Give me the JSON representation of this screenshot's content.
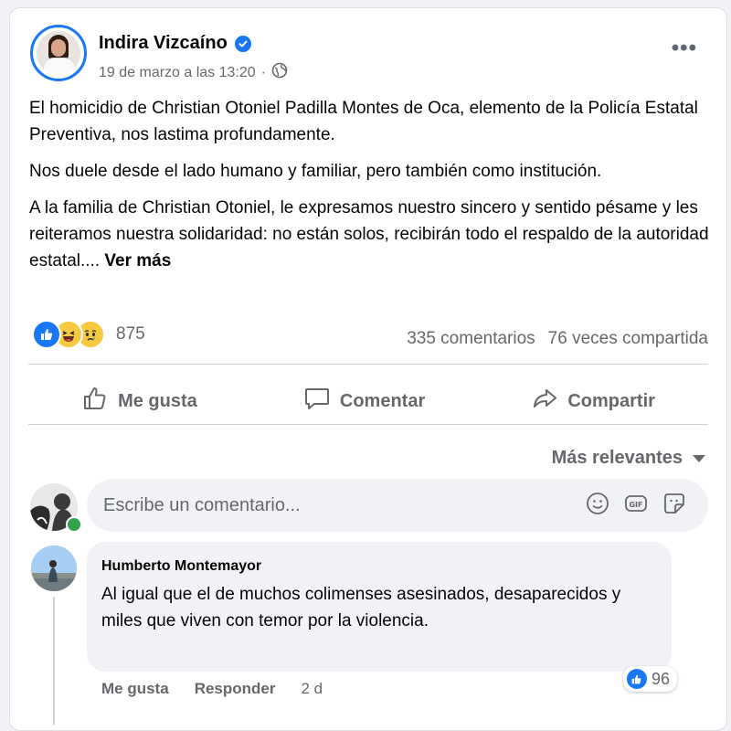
{
  "post": {
    "author": "Indira Vizcaíno",
    "date": "19 de marzo a las 13:20",
    "paragraphs": [
      "El homicidio de Christian Otoniel Padilla Montes de Oca, elemento de la Policía Estatal Preventiva, nos lastima profundamente.",
      "Nos duele desde el lado humano y familiar, pero también como institución.",
      "A la familia de Christian Otoniel, le expresamos nuestro sincero y sentido pésame y les reiteramos nuestra solidaridad: no están solos, recibirán todo el respaldo de la autoridad estatal...."
    ],
    "see_more": "Ver más",
    "reaction_count": "875",
    "comments_count": "335 comentarios",
    "shares_count": "76 veces compartida"
  },
  "actions": {
    "like": "Me gusta",
    "comment": "Comentar",
    "share": "Compartir"
  },
  "sort_label": "Más relevantes",
  "composer": {
    "placeholder": "Escribe un comentario..."
  },
  "comment": {
    "author": "Humberto Montemayor",
    "text": "Al igual que el de muchos colimenses asesinados, desaparecidos y miles que viven con temor por la violencia.",
    "reactions": "96",
    "like": "Me gusta",
    "reply": "Responder",
    "time": "2 d"
  },
  "colors": {
    "accent": "#1877f2",
    "muted": "#65676b",
    "online": "#31a24c"
  }
}
